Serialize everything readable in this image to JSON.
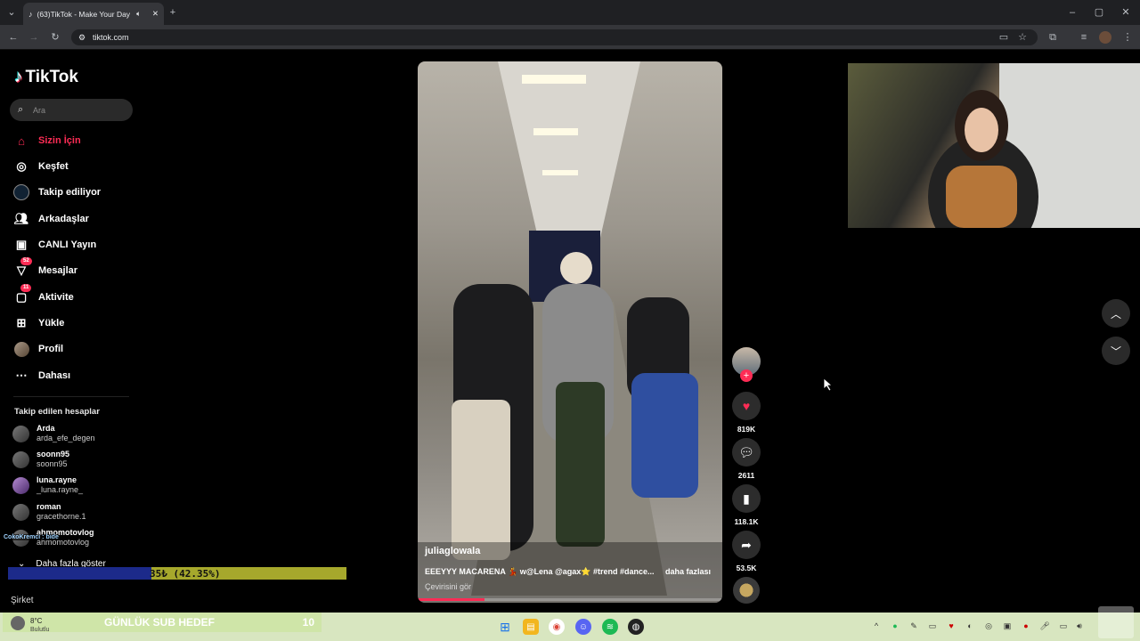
{
  "browser": {
    "tab_title": "(63)TikTok - Make Your Day",
    "url": "tiktok.com"
  },
  "sidebar": {
    "logo": "TikTok",
    "search_placeholder": "Ara",
    "items": [
      {
        "label": "Sizin İçin",
        "icon": "home-icon",
        "active": true
      },
      {
        "label": "Keşfet",
        "icon": "compass-icon"
      },
      {
        "label": "Takip ediliyor",
        "icon": "following-icon"
      },
      {
        "label": "Arkadaşlar",
        "icon": "friends-icon"
      },
      {
        "label": "CANLI Yayın",
        "icon": "live-icon"
      },
      {
        "label": "Mesajlar",
        "icon": "messages-icon",
        "badge": "52"
      },
      {
        "label": "Aktivite",
        "icon": "activity-icon",
        "badge": "11"
      },
      {
        "label": "Yükle",
        "icon": "upload-icon"
      },
      {
        "label": "Profil",
        "icon": "profile-icon"
      },
      {
        "label": "Dahası",
        "icon": "more-icon"
      }
    ],
    "following_title": "Takip edilen hesaplar",
    "accounts": [
      {
        "name": "Arda",
        "handle": "arda_efe_degen"
      },
      {
        "name": "soonn95",
        "handle": "soonn95"
      },
      {
        "name": "luna.rayne",
        "handle": "_luna.rayne_"
      },
      {
        "name": "roman",
        "handle": "gracethorne.1"
      },
      {
        "name": "ahmomotovlog",
        "handle": "ahmomotovlog"
      }
    ],
    "show_more": "Daha fazla göster",
    "company": "Şirket"
  },
  "video": {
    "username": "juliaglowala",
    "caption": "EEEYYY MACARENA 💃 w@Lena @agax⭐ #trend #dance...",
    "more": "daha fazlası",
    "translate": "Çevirisini gör",
    "progress": 0.22
  },
  "actions": {
    "likes": "819K",
    "comments": "2611",
    "saves": "118.1K",
    "shares": "53.5K"
  },
  "overlay": {
    "chat_line": "CokoKremci : bide",
    "goal_percent": "35₺ (42.35%)",
    "goal_fraction": 0.4235,
    "sub_goal_label": "GÜNLÜK SUB HEDEF",
    "sub_goal_value": "10",
    "weather_temp": "8°C",
    "weather_desc": "Bulutlu"
  },
  "colors": {
    "accent": "#fe2c55",
    "goal_fill": "#1c2a8a",
    "goal_bg": "#a6a82c"
  }
}
